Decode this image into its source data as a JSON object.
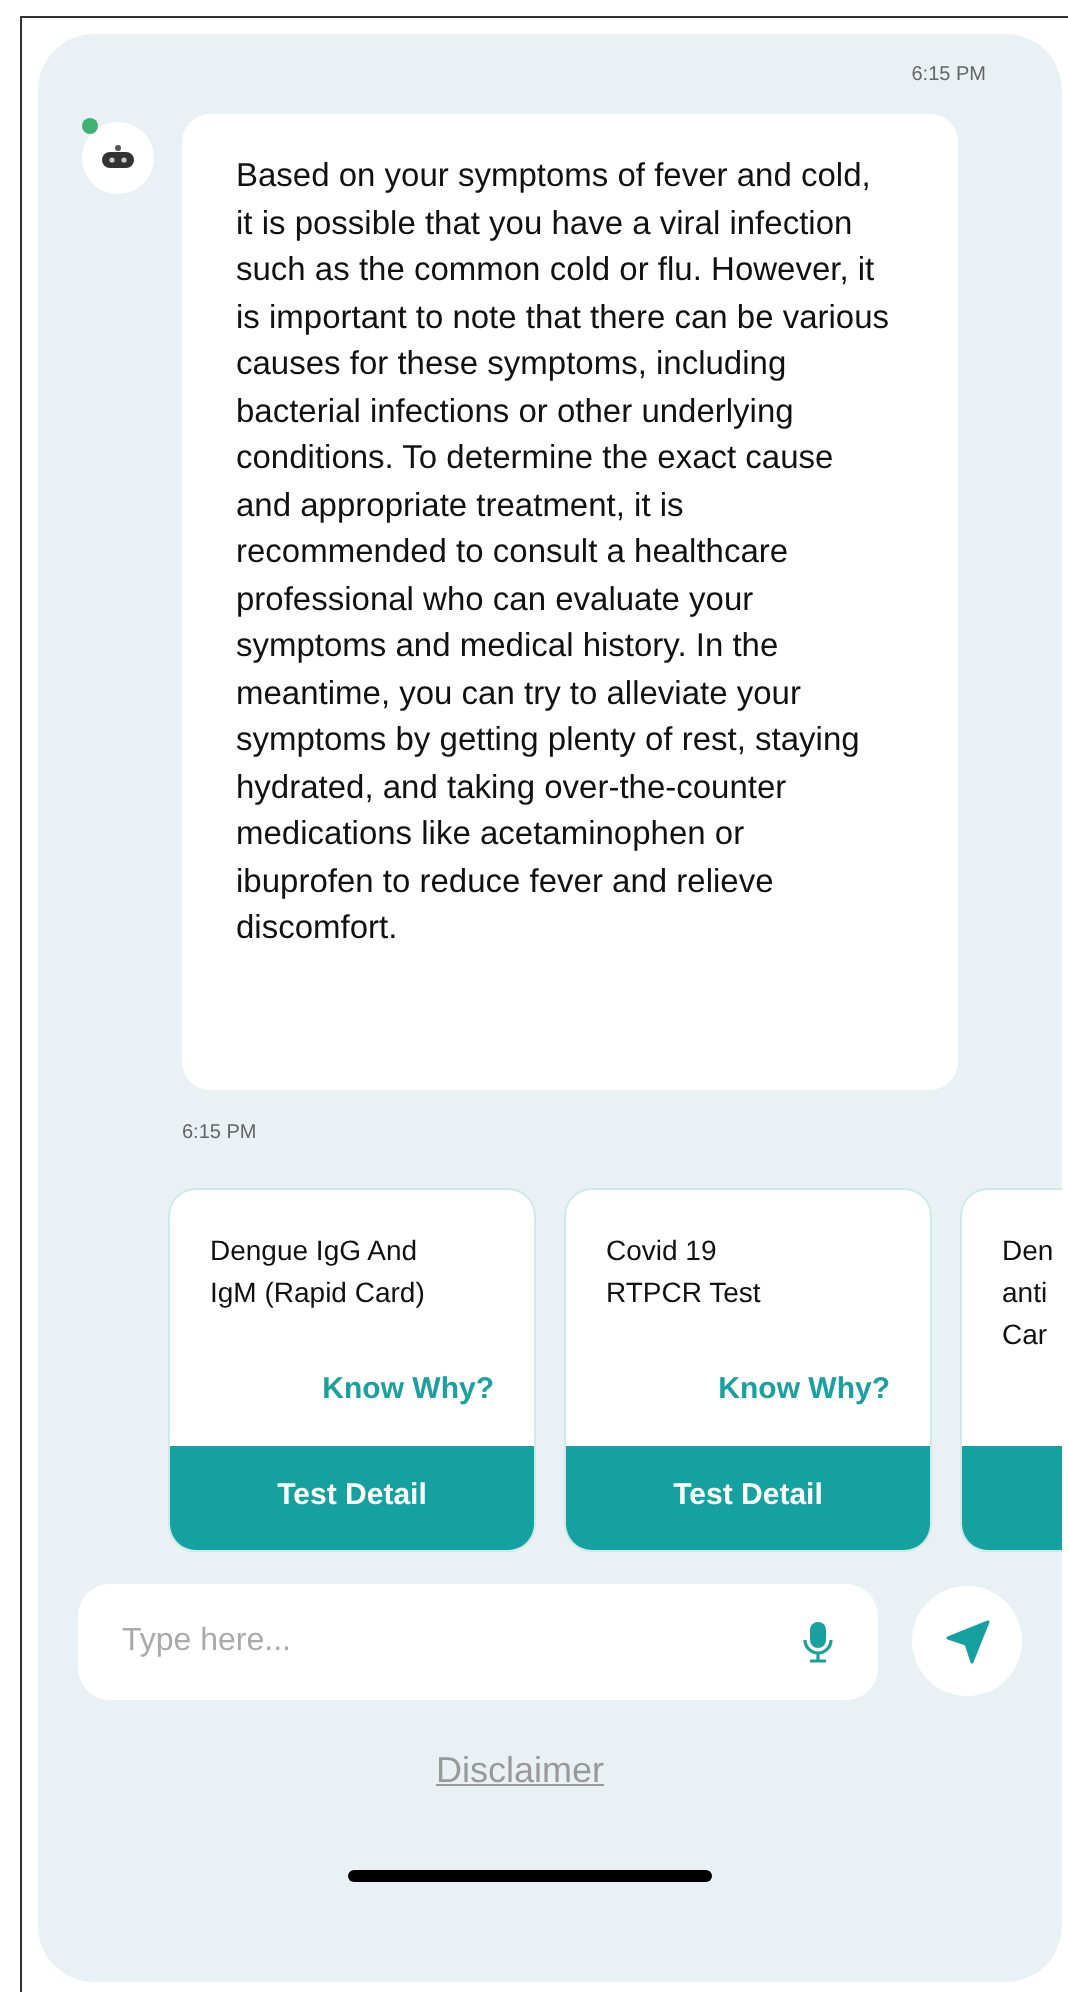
{
  "header": {
    "time": "6:15 PM"
  },
  "bot": {
    "online": true
  },
  "message": {
    "text": "Based on your symptoms of fever and cold, it is possible that you have a viral infection such as the common cold or flu. However, it is important to note that there can be various causes for these symptoms, including bacterial infections or other underlying conditions. To determine the exact cause and appropriate treatment, it is recommended to consult a healthcare professional who can evaluate your symptoms and medical history. In the meantime, you can try to alleviate your symptoms by getting plenty of rest, staying hydrated, and taking over-the-counter medications like acetaminophen or ibuprofen to reduce fever and relieve discomfort.",
    "time": "6:15 PM"
  },
  "tests": [
    {
      "title_lines": [
        "Dengue IgG And",
        "IgM (Rapid Card)"
      ],
      "link": "Know Why?",
      "button": "Test Detail"
    },
    {
      "title_lines": [
        "Covid 19",
        "RTPCR Test"
      ],
      "link": "Know Why?",
      "button": "Test Detail"
    },
    {
      "title_lines": [
        "Den",
        "anti",
        "Car"
      ]
    }
  ],
  "composer": {
    "placeholder": "Type here..."
  },
  "disclaimer": "Disclaimer"
}
